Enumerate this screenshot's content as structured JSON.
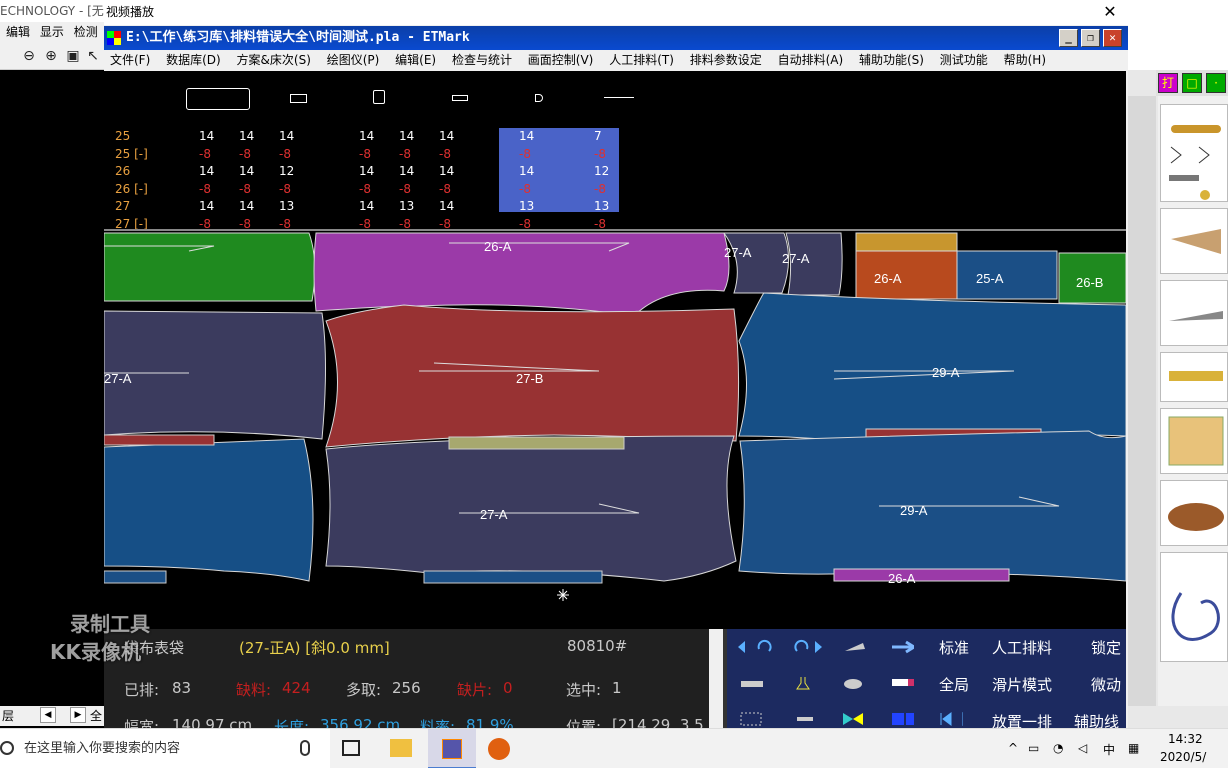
{
  "background_app": {
    "title_fragment": "ECHNOLOGY - [无",
    "menu": [
      "编辑",
      "显示",
      "检测"
    ],
    "bottom_left_label": "层",
    "bottom_fragment": "全"
  },
  "video_window": {
    "title": "视频播放",
    "close_glyph": "✕"
  },
  "etmark": {
    "title": "E:\\工作\\练习库\\排料错误大全\\时间测试.pla - ETMark",
    "menu": [
      "文件(F)",
      "数据库(D)",
      "方案&床次(S)",
      "绘图仪(P)",
      "编辑(E)",
      "检查与统计",
      "画面控制(V)",
      "人工排料(T)",
      "排料参数设定",
      "自动排料(A)",
      "辅助功能(S)",
      "测试功能",
      "帮助(H)"
    ]
  },
  "size_table": {
    "rows": [
      {
        "label": "25",
        "values": [
          "14",
          "14",
          "14",
          "14",
          "14",
          "14",
          "14",
          "7"
        ],
        "neg": false
      },
      {
        "label": "25 [-]",
        "values": [
          "-8",
          "-8",
          "-8",
          "-8",
          "-8",
          "-8",
          "-8",
          "-8"
        ],
        "neg": true
      },
      {
        "label": "26",
        "values": [
          "14",
          "14",
          "12",
          "14",
          "14",
          "14",
          "14",
          "12"
        ],
        "neg": false
      },
      {
        "label": "26 [-]",
        "values": [
          "-8",
          "-8",
          "-8",
          "-8",
          "-8",
          "-8",
          "-8",
          "-8"
        ],
        "neg": true
      },
      {
        "label": "27",
        "values": [
          "14",
          "14",
          "13",
          "14",
          "13",
          "14",
          "13",
          "13"
        ],
        "neg": false
      },
      {
        "label": "27 [-]",
        "values": [
          "-8",
          "-8",
          "-8",
          "-8",
          "-8",
          "-8",
          "-8",
          "-8"
        ],
        "neg": true
      }
    ]
  },
  "marker": {
    "pieces": [
      {
        "id": "p1",
        "label": "",
        "color": "#1f8a1f"
      },
      {
        "id": "p2",
        "label": "26-A",
        "color": "#9b3aa8"
      },
      {
        "id": "p3",
        "label": "27-A",
        "color": "#3b3b5e"
      },
      {
        "id": "p4",
        "label": "27-A",
        "color": "#3b3b5e"
      },
      {
        "id": "p5",
        "label": "",
        "color": "#c8962e"
      },
      {
        "id": "p6",
        "label": "26-A",
        "color": "#b84a1e"
      },
      {
        "id": "p7",
        "label": "25-A",
        "color": "#1b4f86"
      },
      {
        "id": "p8",
        "label": "26-B",
        "color": "#1f8a1f"
      },
      {
        "id": "p9",
        "label": "27-A",
        "color": "#3b3b5e"
      },
      {
        "id": "p10",
        "label": "27-B",
        "color": "#983233"
      },
      {
        "id": "p11",
        "label": "29-A",
        "color": "#164f86"
      },
      {
        "id": "p12",
        "label": "27-A",
        "color": "#3b3b5e"
      },
      {
        "id": "p13",
        "label": "29-A",
        "color": "#164f86"
      },
      {
        "id": "p14",
        "label": "",
        "color": "#983233"
      },
      {
        "id": "p15",
        "label": "29-A",
        "color": "#1b4f86"
      },
      {
        "id": "p16",
        "label": "26-A",
        "color": "#9b3aa8"
      }
    ]
  },
  "status": {
    "piece": "袋布表袋",
    "selected": "(27-正A) [斜0.0 mm]",
    "code": "80810#",
    "placed_label": "已排:",
    "placed": "83",
    "missing_label": "缺料:",
    "missing": "424",
    "extra_label": "多取:",
    "extra": "256",
    "shortage_label": "缺片:",
    "shortage": "0",
    "select_label": "选中:",
    "select": "1",
    "width_label": "幅宽:",
    "width": "140.97 cm",
    "length_label": "长度:",
    "length": "356.92 cm",
    "rate_label": "料率:",
    "rate": "81.9%",
    "pos_label": "位置:",
    "pos": "[214.29, 3.5"
  },
  "tools": {
    "row1": [
      "标准",
      "人工排料",
      "锁定"
    ],
    "row2": [
      "全局",
      "滑片模式",
      "微动"
    ],
    "row3": [
      "放置一排",
      "辅助线"
    ]
  },
  "watermark": {
    "line1": "录制工具",
    "line2": "KK录像机"
  },
  "taskbar": {
    "search_placeholder": "在这里输入你要搜索的内容",
    "time": "14:32",
    "date": "2020/5/",
    "ime": "中"
  },
  "right_panel": {
    "tool_label": "打"
  },
  "colors": {
    "accent": "#0a4ad0",
    "selection": "#4a63c8"
  }
}
